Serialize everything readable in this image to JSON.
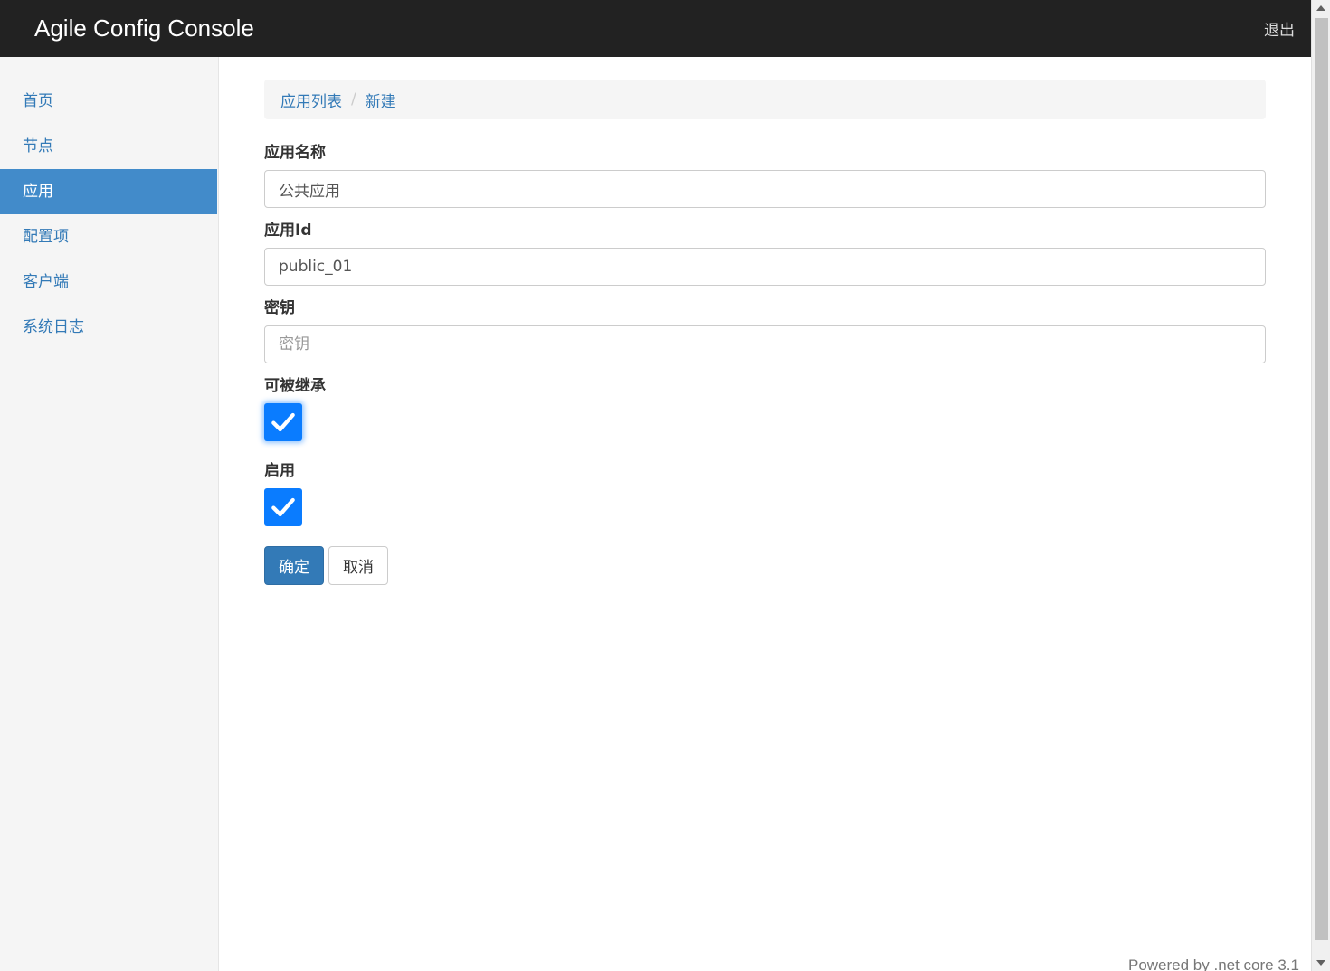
{
  "navbar": {
    "brand": "Agile Config Console",
    "logout_label": "退出"
  },
  "sidebar": {
    "items": [
      {
        "label": "首页",
        "active": false
      },
      {
        "label": "节点",
        "active": false
      },
      {
        "label": "应用",
        "active": true
      },
      {
        "label": "配置项",
        "active": false
      },
      {
        "label": "客户端",
        "active": false
      },
      {
        "label": "系统日志",
        "active": false
      }
    ]
  },
  "breadcrumb": {
    "items": [
      "应用列表",
      "新建"
    ],
    "separator": "/"
  },
  "form": {
    "app_name": {
      "label": "应用名称",
      "value": "公共应用"
    },
    "app_id": {
      "label": "应用Id",
      "value": "public_01"
    },
    "secret": {
      "label": "密钥",
      "value": "",
      "placeholder": "密钥"
    },
    "inheritable": {
      "label": "可被继承",
      "checked": true
    },
    "enabled": {
      "label": "启用",
      "checked": true
    },
    "confirm_label": "确定",
    "cancel_label": "取消"
  },
  "footer": {
    "text": "Powered by .net core 3.1"
  },
  "colors": {
    "navbar_bg": "#222222",
    "sidebar_active": "#428bca",
    "link": "#337ab7",
    "checkbox": "#0a7cff",
    "primary_button": "#337ab7"
  }
}
